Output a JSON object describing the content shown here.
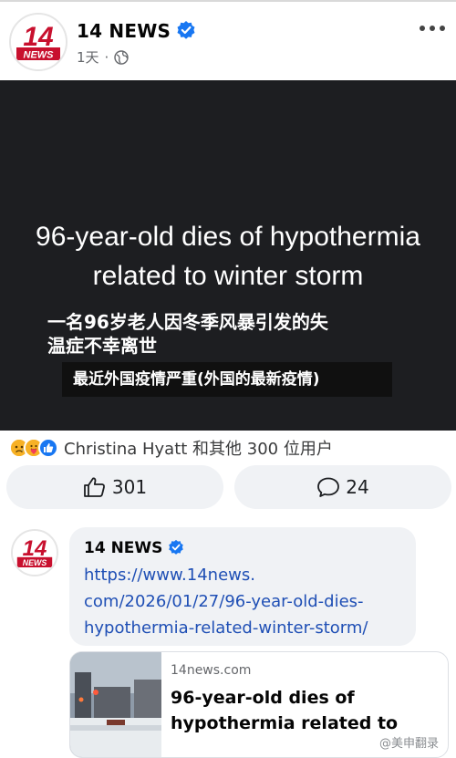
{
  "post": {
    "page_name": "14 NEWS",
    "logo_text": "14",
    "logo_subtext": "NEWS",
    "time": "1天",
    "separator": "·",
    "privacy_icon": "globe-icon",
    "menu_icon": "more-icon"
  },
  "media": {
    "headline_line1": "96-year-old dies of hypothermia",
    "headline_line2": "related to winter storm",
    "subtitle_line1": "一名96岁老人因冬季风暴引发的失",
    "subtitle_line2": "温症不幸离世",
    "caption": "最近外国疫情严重(外国的最新疫情)"
  },
  "reactions": {
    "icons": [
      "sad-icon",
      "care-icon",
      "like-icon"
    ],
    "summary": "Christina Hyatt 和其他 300 位用户"
  },
  "actions": {
    "like_count": "301",
    "comment_count": "24"
  },
  "comment": {
    "author": "14 NEWS",
    "link_line1": "https://www.14news.",
    "link_line2": "com/2026/01/27/96-year-old-dies-",
    "link_line3": "hypothermia-related-winter-storm/"
  },
  "link_preview": {
    "domain": "14news.com",
    "title_line1": "96-year-old dies of",
    "title_line2": "hypothermia related to"
  },
  "watermark": "@美申翻录",
  "colors": {
    "brand_red": "#c8102e",
    "verified_blue": "#1877f2",
    "link_blue": "#1f4fb5",
    "media_bg": "#1d1e21",
    "button_bg": "#f0f2f5"
  }
}
